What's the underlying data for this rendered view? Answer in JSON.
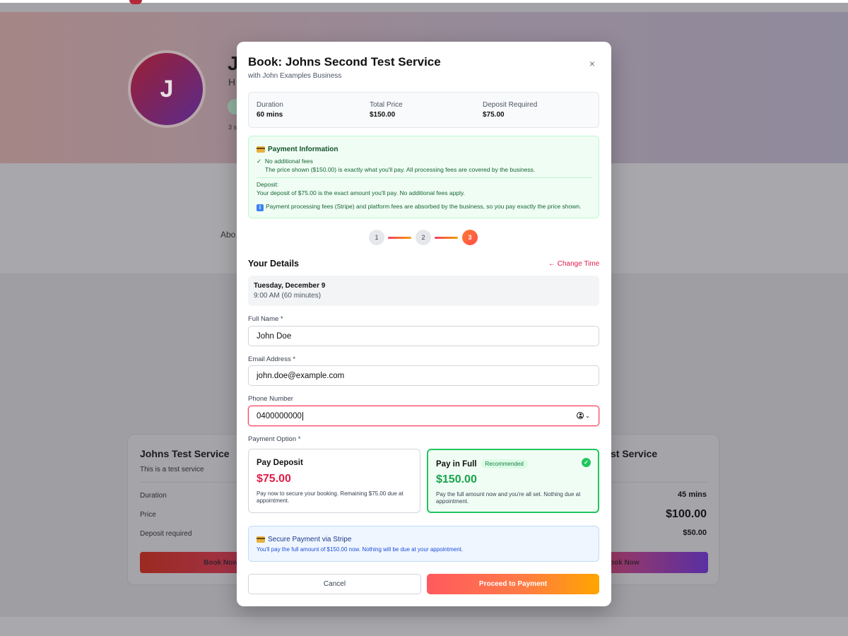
{
  "background": {
    "avatar_initial": "J",
    "business_name_fragment": "J",
    "business_sub_fragment": "H",
    "small_fragment": "3 s",
    "about_fragment": "Abo",
    "cards": [
      {
        "title": "Johns Test Service",
        "description": "This is a test service",
        "rows": [
          {
            "label": "Duration",
            "value": ""
          },
          {
            "label": "Price",
            "value": ""
          },
          {
            "label": "Deposit required",
            "value": ""
          }
        ],
        "button": "Book Now"
      },
      {
        "title": "st Service",
        "rows": [
          {
            "label": "",
            "value": "45 mins"
          },
          {
            "label": "",
            "value": "$100.00"
          },
          {
            "label": "",
            "value": "$50.00"
          }
        ],
        "button": "ook Now"
      }
    ]
  },
  "modal": {
    "title": "Book: Johns Second Test Service",
    "subtitle": "with John Examples Business",
    "close_icon": "×",
    "summary": {
      "duration_label": "Duration",
      "duration_value": "60 mins",
      "price_label": "Total Price",
      "price_value": "$150.00",
      "deposit_label": "Deposit Required",
      "deposit_value": "$75.00"
    },
    "payment_info": {
      "title": "Payment Information",
      "no_fees_title": "No additional fees",
      "no_fees_desc": "The price shown ($150.00) is exactly what you'll pay. All processing fees are covered by the business.",
      "deposit_label": "Deposit:",
      "deposit_desc": "Your deposit of $75.00 is the exact amount you'll pay. No additional fees apply.",
      "processing_note": "Payment processing fees (Stripe) and platform fees are absorbed by the business, so you pay exactly the price shown."
    },
    "steps": [
      "1",
      "2",
      "3"
    ],
    "section_title": "Your Details",
    "change_time": "← Change Time",
    "selected_date": "Tuesday, December 9",
    "selected_time": "9:00 AM (60 minutes)",
    "fields": {
      "name_label": "Full Name *",
      "name_value": "John Doe",
      "email_label": "Email Address *",
      "email_value": "john.doe@example.com",
      "phone_label": "Phone Number",
      "phone_value": "0400000000"
    },
    "payment_option_label": "Payment Option *",
    "options": {
      "deposit": {
        "title": "Pay Deposit",
        "price": "$75.00",
        "desc": "Pay now to secure your booking. Remaining $75.00 due at appointment."
      },
      "full": {
        "title": "Pay in Full",
        "badge": "Recommended",
        "price": "$150.00",
        "desc": "Pay the full amount now and you're all set. Nothing due at appointment."
      }
    },
    "secure": {
      "title": "Secure Payment via Stripe",
      "desc": "You'll pay the full amount of $150.00 now. Nothing will be due at your appointment."
    },
    "buttons": {
      "cancel": "Cancel",
      "proceed": "Proceed to Payment"
    }
  },
  "colors": {
    "accent": "#e11d48",
    "success": "#22c55e",
    "info": "#3b82f6"
  },
  "icons": {
    "close": "close-icon",
    "credit_card": "credit-card-icon",
    "info": "info-icon",
    "check": "check-icon",
    "contact": "contact-person-icon"
  }
}
